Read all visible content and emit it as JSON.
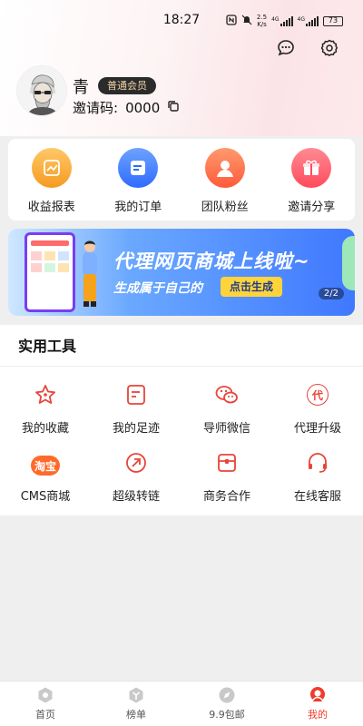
{
  "status_bar": {
    "time": "18:27",
    "network_speed_value": "2.5",
    "network_speed_unit": "K/s",
    "signal_1": "4G",
    "signal_2": "4G",
    "battery": "73"
  },
  "profile": {
    "name": "青",
    "member_badge": "普通会员",
    "invite_label": "邀请码:",
    "invite_code": "0000"
  },
  "quick_actions": [
    {
      "label": "收益报表",
      "icon": "chart-up-icon",
      "color": "#f5a22a"
    },
    {
      "label": "我的订单",
      "icon": "order-list-icon",
      "color": "#3d7bff"
    },
    {
      "label": "团队粉丝",
      "icon": "user-icon",
      "color": "#ff6a4a"
    },
    {
      "label": "邀请分享",
      "icon": "gift-icon",
      "color": "#ff5d6c"
    }
  ],
  "banner": {
    "title": "代理网页商城上线啦~",
    "subtitle": "生成属于自己的",
    "cta": "点击生成",
    "pager": "2/2"
  },
  "tools": {
    "title": "实用工具",
    "items": [
      {
        "label": "我的收藏",
        "icon": "star-icon"
      },
      {
        "label": "我的足迹",
        "icon": "footprint-icon"
      },
      {
        "label": "导师微信",
        "icon": "wechat-icon"
      },
      {
        "label": "代理升级",
        "icon": "agent-upgrade-icon",
        "glyph": "代"
      },
      {
        "label": "CMS商城",
        "icon": "taobao-icon",
        "glyph": "淘宝"
      },
      {
        "label": "超级转链",
        "icon": "link-icon"
      },
      {
        "label": "商务合作",
        "icon": "business-icon"
      },
      {
        "label": "在线客服",
        "icon": "headset-icon"
      }
    ]
  },
  "tabbar": [
    {
      "label": "首页",
      "icon": "home-icon",
      "active": false
    },
    {
      "label": "榜单",
      "icon": "ranking-icon",
      "active": false
    },
    {
      "label": "9.9包邮",
      "icon": "compass-icon",
      "active": false
    },
    {
      "label": "我的",
      "icon": "profile-icon",
      "active": true
    }
  ],
  "colors": {
    "accent": "#ef3b2b",
    "tool_icon": "#e8443a"
  }
}
